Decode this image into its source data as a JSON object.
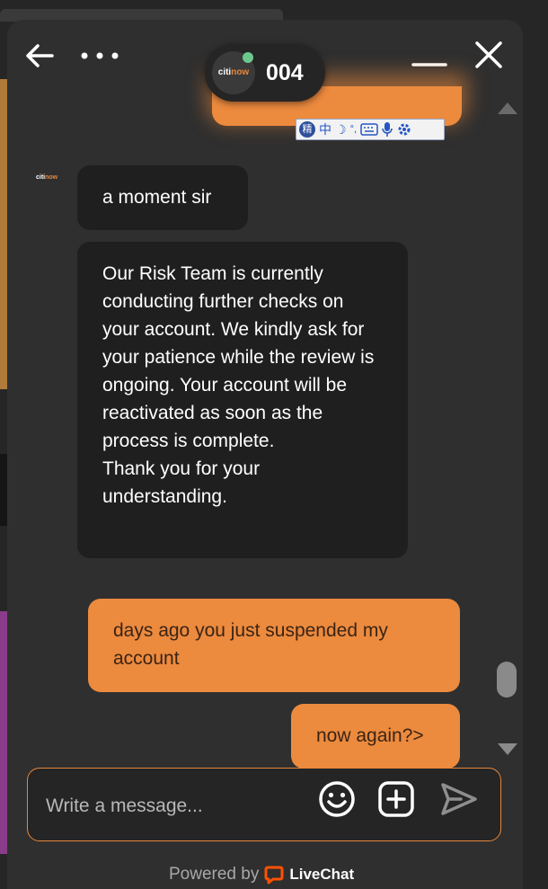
{
  "header": {
    "agent_name": "004",
    "agent_logo_text": "citi",
    "agent_logo_accent": "now",
    "agent_status": "online"
  },
  "ime_toolbar": {
    "logo": "精",
    "lang": "中",
    "moon": "☽",
    "punct": "°,"
  },
  "messages": [
    {
      "from": "agent",
      "text": "a moment sir"
    },
    {
      "from": "agent",
      "text": "Our Risk Team is currently conducting further checks on your account. We kindly ask for your patience while the review is ongoing. Your account will be reactivated as soon as the process is complete.\nThank you for your understanding."
    },
    {
      "from": "visitor",
      "text": "days ago you just suspended my account"
    },
    {
      "from": "visitor",
      "text": "now again?>"
    }
  ],
  "composer": {
    "placeholder": "Write a message..."
  },
  "footer": {
    "powered_by": "Powered by",
    "brand": "LiveChat"
  },
  "colors": {
    "accent": "#ec8a3e",
    "online": "#6cc98e",
    "agent_bubble": "#1f1f1f",
    "panel": "#2f2f2f"
  }
}
